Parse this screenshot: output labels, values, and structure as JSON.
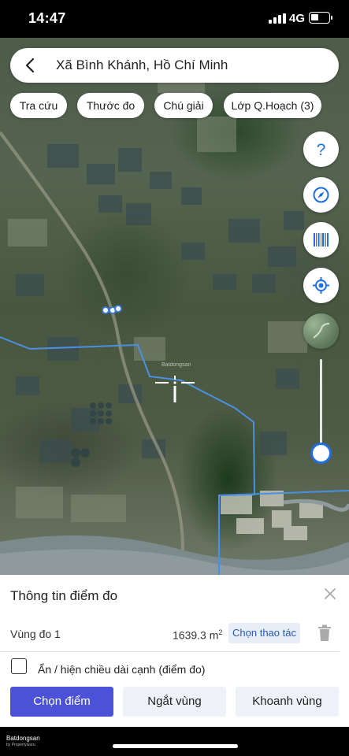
{
  "status_bar": {
    "time": "14:47",
    "network": "4G"
  },
  "search": {
    "location": "Xã Bình Khánh, Hồ Chí Minh"
  },
  "chips": [
    {
      "label": "Tra cứu"
    },
    {
      "label": "Thước đo"
    },
    {
      "label": "Chú giải"
    },
    {
      "label": "Lớp Q.Hoạch (3)"
    }
  ],
  "map_buttons": [
    "help-icon",
    "compass-icon",
    "barcode-icon",
    "locate-icon",
    "satellite-layer-icon"
  ],
  "map_watermark": "Batdongsan",
  "panel": {
    "title": "Thông tin điểm đo",
    "region_label": "Vùng đo 1",
    "area_value": "1639.3 m",
    "area_unit_exp": "2",
    "choose_action": "Chọn thao tác",
    "toggle_label": "Ẩn / hiện chiều dài cạnh (điểm đo)",
    "buttons": {
      "choose_point": "Chọn điểm",
      "disconnect_region": "Ngắt vùng",
      "enclose_region": "Khoanh vùng"
    }
  },
  "footer": {
    "brand_line1": "Batdongsan",
    "brand_line2": "by PropertyGuru"
  },
  "colors": {
    "primary": "#4c52d8",
    "accent_blue": "#1f6fe0",
    "boundary": "#4a90e2"
  }
}
